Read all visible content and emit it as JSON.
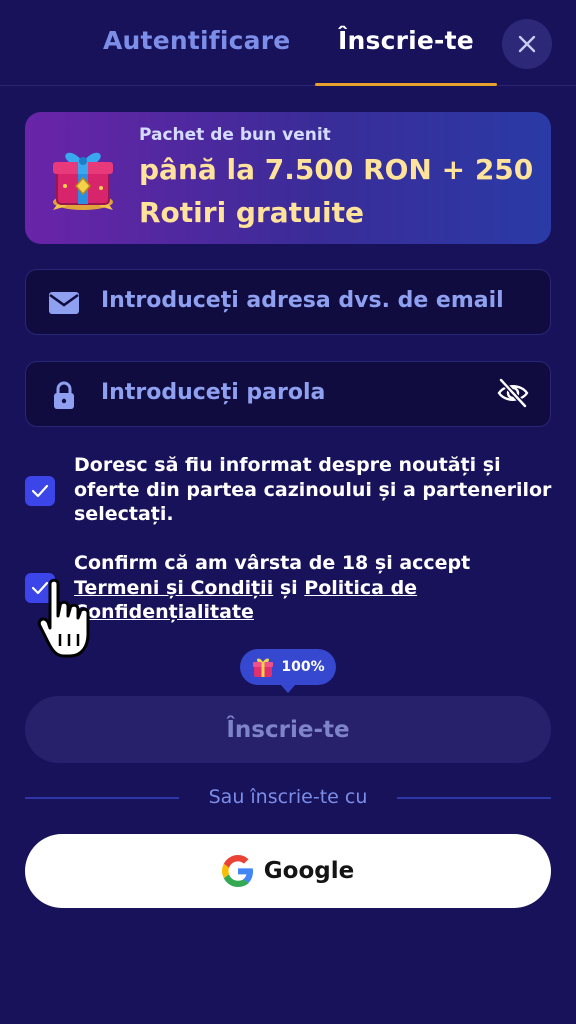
{
  "tabs": [
    {
      "label": "Autentificare",
      "active": false
    },
    {
      "label": "Înscrie-te",
      "active": true
    }
  ],
  "close_icon": "close-icon",
  "colors": {
    "background": "#17125a",
    "accent_underline": "#e8a12c",
    "checkbox": "#3b45e8",
    "banner_highlight": "#ffe39a",
    "placeholder": "#8ea0ef"
  },
  "banner": {
    "subtitle": "Pachet de bun venit",
    "title": "până la 7.500 RON + 250 Rotiri gratuite",
    "icon": "gift-box-icon"
  },
  "email_field": {
    "placeholder": "Introduceți adresa dvs. de email",
    "value": "",
    "icon": "envelope-icon"
  },
  "password_field": {
    "placeholder": "Introduceți parola",
    "value": "",
    "icon": "lock-icon",
    "toggle_icon": "eye-off-icon"
  },
  "consents": {
    "newsletter": {
      "checked": true,
      "text": "Doresc să fiu informat despre noutăți și oferte din partea cazinoului și a partenerilor selectați."
    },
    "terms": {
      "checked": true,
      "text_before": "Confirm că am vârsta de 18 și accept ",
      "terms_link": "Termeni și Condiții",
      "middle": " și ",
      "privacy_link": "Politica de Confidențialitate"
    }
  },
  "bonus_badge": {
    "value": "100%",
    "icon": "gift-icon"
  },
  "submit_button": {
    "label": "Înscrie-te"
  },
  "divider": {
    "text": "Sau înscrie-te cu"
  },
  "google_button": {
    "label": "Google",
    "icon": "google-icon"
  }
}
